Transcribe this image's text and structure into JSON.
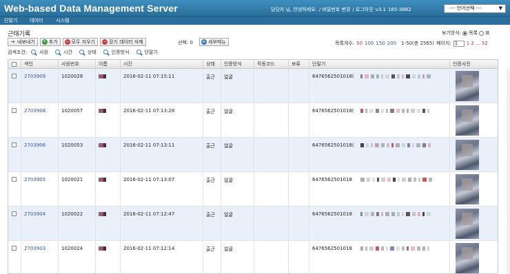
{
  "header": {
    "app_title": "Web-based Data Management Server",
    "greeting": "담당자 님, 안녕하세요.",
    "links": [
      "/ 비밀번호 변경",
      "/ 로그아웃"
    ],
    "version": "v3.1",
    "phone": "165-3882",
    "language_select": "--- 언어선택 ---"
  },
  "nav": [
    "단말기",
    "데이터",
    "시스템"
  ],
  "page": {
    "section_title": "근태기록",
    "toolbar": {
      "export": "내보내기",
      "add": "추가",
      "delete_all": "모두 지우기",
      "delete_device_data": "장기 데이터 삭제"
    },
    "selection": "선택: 0",
    "detail_menu": "세부메뉴",
    "view_mode": {
      "label": "보기방식:",
      "option_list": "목록",
      "option_table": "표"
    },
    "pager": {
      "rows_label": "목록개수:",
      "sizes": [
        "50",
        "100",
        "150",
        "200"
      ],
      "active_size": "50",
      "range": "1-50(총 2565)",
      "page_label": "페이지:",
      "page_value": "1",
      "pages": "1 2 ... 52"
    },
    "search": {
      "label": "검색조건:",
      "fields": [
        "사원",
        "시간",
        "상태",
        "인증방식",
        "단말기"
      ]
    }
  },
  "table": {
    "columns": [
      "색인",
      "사원번호",
      "이름",
      "시간",
      "상태",
      "인증방식",
      "작동코드",
      "보류",
      "단말기",
      "인증사진"
    ],
    "rows": [
      {
        "index": "2703909",
        "emp_no": "1020028",
        "time": "2016-02-11 07:15:11",
        "status": "출근",
        "auth": "얼굴",
        "device": "6476562501018("
      },
      {
        "index": "2703908",
        "emp_no": "1020057",
        "time": "2016-02-11 07:13:28",
        "status": "출근",
        "auth": "얼굴",
        "device": "6476562501018("
      },
      {
        "index": "2703906",
        "emp_no": "1020053",
        "time": "2016-02-11 07:13:11",
        "status": "출근",
        "auth": "얼굴",
        "device": "6476562501018("
      },
      {
        "index": "2703905",
        "emp_no": "1020021",
        "time": "2016-02-11 07:13:07",
        "status": "출근",
        "auth": "얼굴",
        "device": "6476562501018"
      },
      {
        "index": "2703904",
        "emp_no": "1020022",
        "time": "2016-02-11 07:12:47",
        "status": "출근",
        "auth": "얼굴",
        "device": "6476562501018"
      },
      {
        "index": "2703903",
        "emp_no": "1020024",
        "time": "2016-02-11 07:12:14",
        "status": "출근",
        "auth": "얼굴",
        "device": "6476562501018"
      }
    ]
  }
}
